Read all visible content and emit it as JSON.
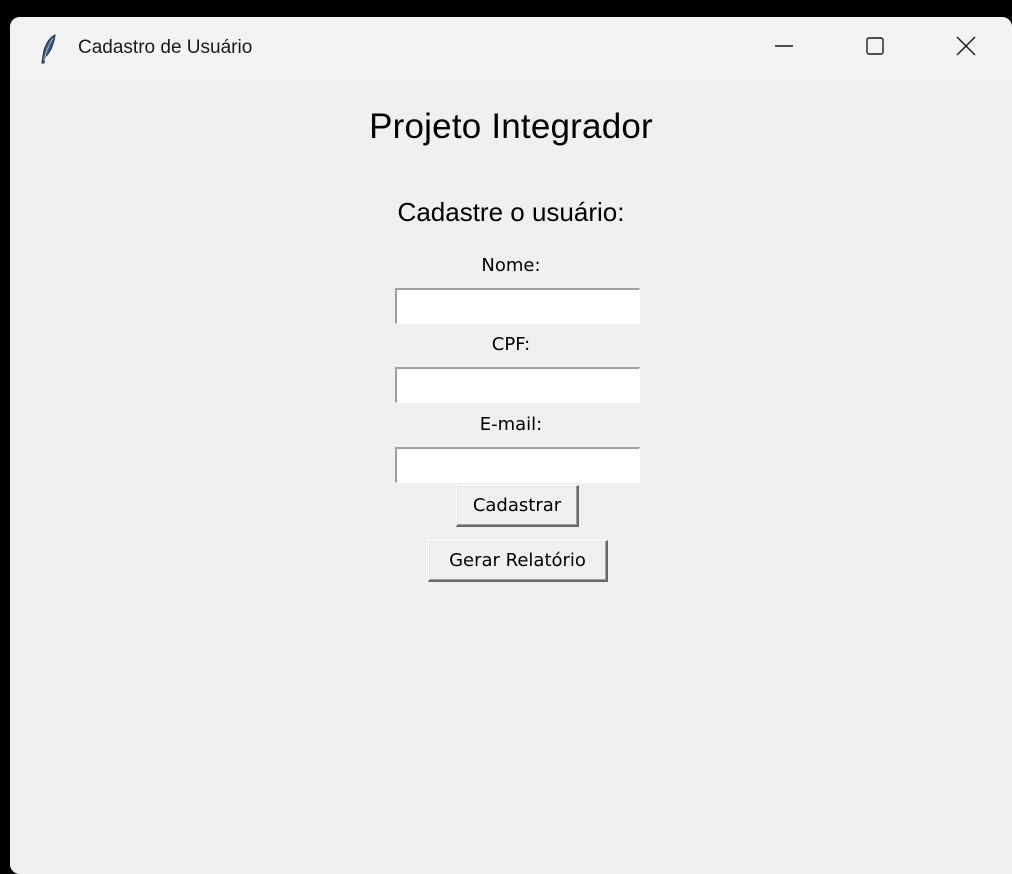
{
  "window": {
    "title": "Cadastro de Usuário",
    "app_icon": "feather-icon",
    "controls": {
      "minimize_icon": "minimize-icon",
      "maximize_icon": "maximize-icon",
      "close_icon": "close-icon"
    }
  },
  "form": {
    "heading": "Projeto Integrador",
    "subheading": "Cadastre o usuário:",
    "fields": [
      {
        "label": "Nome:",
        "value": ""
      },
      {
        "label": "CPF:",
        "value": ""
      },
      {
        "label": "E-mail:",
        "value": ""
      }
    ],
    "buttons": {
      "register_label": "Cadastrar",
      "report_label": "Gerar Relatório"
    }
  },
  "colors": {
    "window_background": "#f0f0f0",
    "titlebar_background": "#f3f3f3",
    "entry_background": "#ffffff",
    "text": "#000000"
  }
}
